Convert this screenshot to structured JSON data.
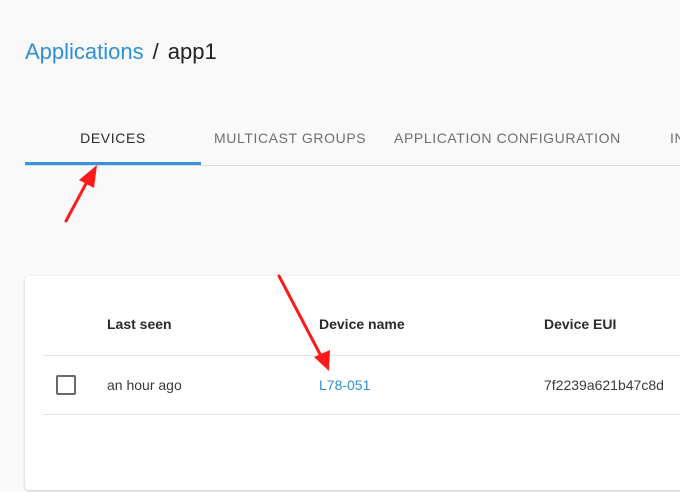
{
  "breadcrumb": {
    "parent": "Applications",
    "separator": "/",
    "current": "app1"
  },
  "tabs": [
    {
      "label": "DEVICES",
      "active": true
    },
    {
      "label": "MULTICAST GROUPS",
      "active": false
    },
    {
      "label": "APPLICATION CONFIGURATION",
      "active": false
    },
    {
      "label": "IN",
      "active": false
    }
  ],
  "table": {
    "columns": [
      "Last seen",
      "Device name",
      "Device EUI"
    ],
    "rows": [
      {
        "last_seen": "an hour ago",
        "device_name": "L78-051",
        "device_eui": "7f2239a621b47c8d"
      }
    ]
  },
  "colors": {
    "accent": "#3c8fdb",
    "link": "#2f8fd8",
    "annotation_arrow": "#ff1a1a"
  },
  "annotations": [
    {
      "type": "arrow",
      "points_to": "tab-devices"
    },
    {
      "type": "arrow",
      "points_to": "device-name-link"
    }
  ]
}
